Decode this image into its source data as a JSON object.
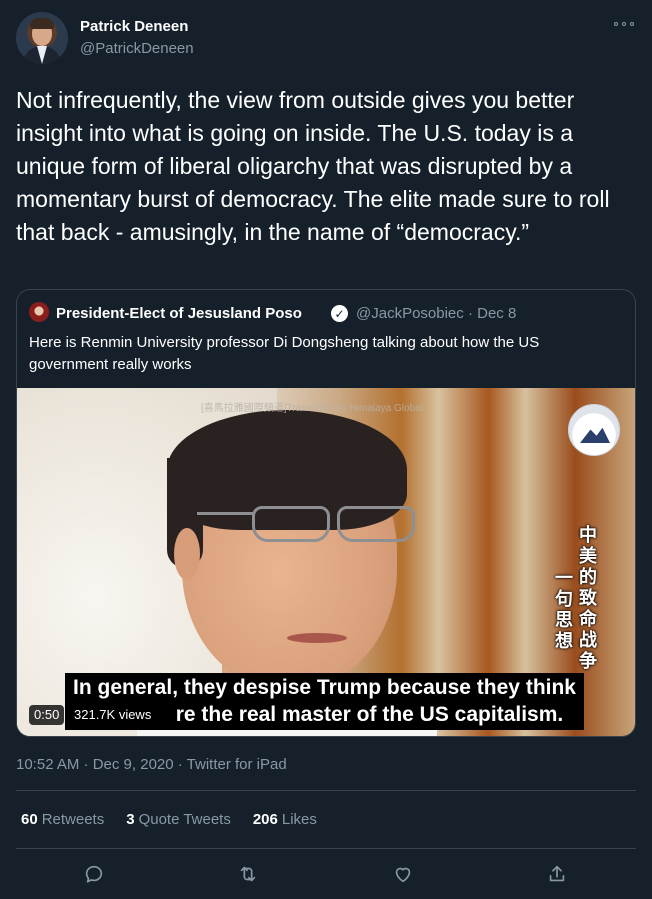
{
  "author": {
    "name": "Patrick Deneen",
    "handle": "@PatrickDeneen"
  },
  "tweet": {
    "text": "Not infrequently, the view from outside gives you better insight into what is going on inside. The U.S. today is a unique form of liberal oligarchy that was disrupted by a momentary burst of democracy. The elite made sure to roll that back - amusingly, in the name of “democracy.”"
  },
  "quoted": {
    "name": "President-Elect of Jesusland Poso",
    "handle_date": "@JackPosobiec · Dec 8",
    "text": "Here is Renmin University professor Di Dongsheng talking about how the US government really works",
    "video": {
      "watermark": "[喜馬拉雅國際頻道]Translated by Himalaya Global",
      "cjk_right": "中美的致命战争",
      "cjk_left": "一句思想",
      "subtitle_line1": "In general, they despise Trump because they think",
      "subtitle_line2": "re the real master of the US capitalism.",
      "duration": "0:50",
      "views": "321.7K views"
    }
  },
  "timestamp": "10:52 AM · Dec 9, 2020 · Twitter for iPad",
  "stats": [
    {
      "count": "60",
      "label": "Retweets"
    },
    {
      "count": "3",
      "label": "Quote Tweets"
    },
    {
      "count": "206",
      "label": "Likes"
    }
  ],
  "actions": [
    "reply-icon",
    "retweet-icon",
    "like-icon",
    "share-icon"
  ],
  "colors": {
    "background": "#15202b",
    "border": "#38444d",
    "secondary_text": "#8899a6",
    "primary_text": "#ffffff"
  }
}
